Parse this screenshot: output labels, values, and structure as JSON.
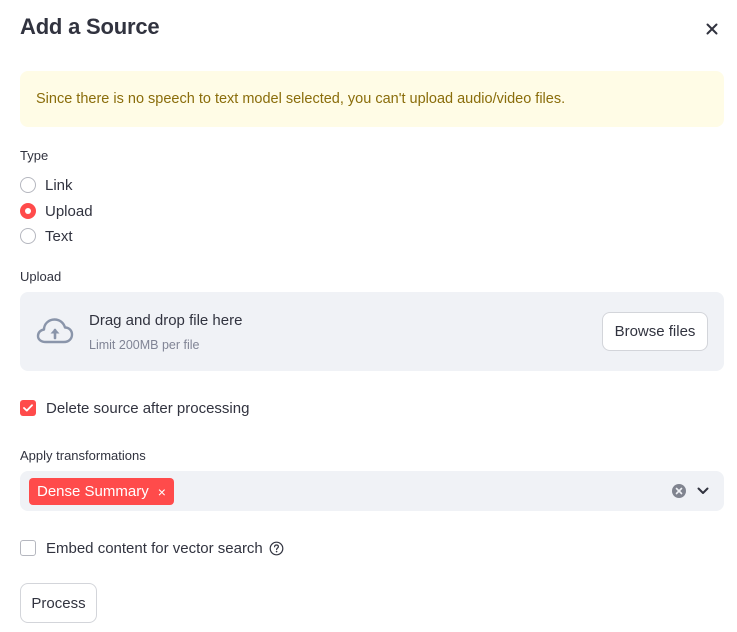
{
  "dialog": {
    "title": "Add a Source",
    "close_icon": "close-icon"
  },
  "warning": {
    "text": "Since there is no speech to text model selected, you can't upload audio/video files.",
    "background": "#fffce6",
    "text_color": "#8a6d0b"
  },
  "type_group": {
    "label": "Type",
    "options": [
      {
        "label": "Link",
        "selected": false
      },
      {
        "label": "Upload",
        "selected": true
      },
      {
        "label": "Text",
        "selected": false
      }
    ]
  },
  "upload": {
    "label": "Upload",
    "drop_text": "Drag and drop file here",
    "limit_text": "Limit 200MB per file",
    "browse_label": "Browse files",
    "icon": "cloud-upload-icon"
  },
  "delete_source": {
    "label": "Delete source after processing",
    "checked": true
  },
  "transformations": {
    "label": "Apply transformations",
    "selected": [
      {
        "label": "Dense Summary",
        "remove": "×"
      }
    ]
  },
  "embed": {
    "label": "Embed content for vector search",
    "checked": false,
    "help_icon": "help-icon"
  },
  "process": {
    "label": "Process"
  },
  "colors": {
    "accent": "#ff4b4b",
    "text": "#31333f",
    "input_bg": "#f0f2f6"
  }
}
